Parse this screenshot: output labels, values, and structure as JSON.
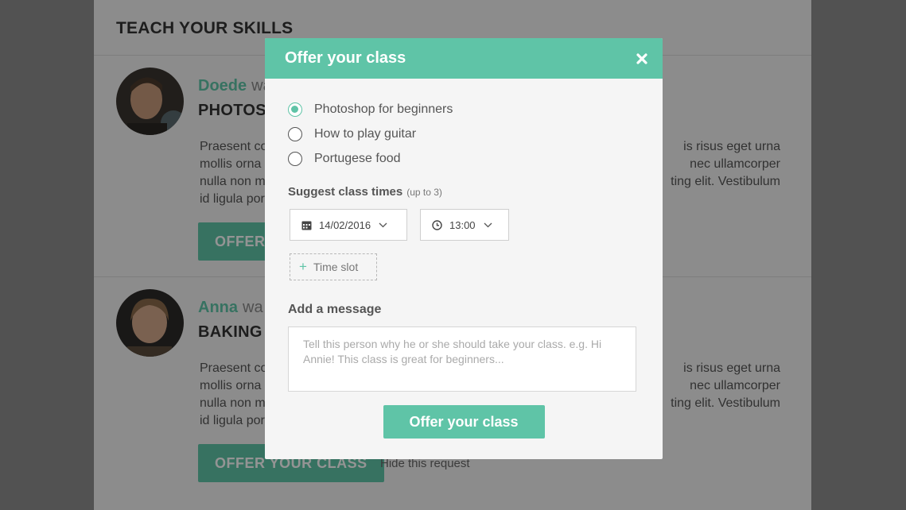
{
  "background": {
    "title": "TEACH YOUR SKILLS",
    "requests": [
      {
        "name": "Doede",
        "wants": "wa",
        "skill": "PHOTOS",
        "text_left": [
          "Praesent co",
          "mollis orna",
          "nulla non m",
          "id ligula por"
        ],
        "text_right": [
          "is risus eget urna",
          "nec ullamcorper",
          "ting elit. Vestibulum"
        ],
        "offer_label": "OFFER Y"
      },
      {
        "name": "Anna",
        "wants": "wa",
        "skill": "BAKING",
        "text_left": [
          "Praesent co",
          "mollis orna",
          "nulla non m",
          "id ligula por"
        ],
        "text_right": [
          "is risus eget urna",
          "nec ullamcorper",
          "ting elit. Vestibulum"
        ],
        "offer_label": "OFFER YOUR CLASS",
        "hide_label": "Hide this request"
      }
    ]
  },
  "modal": {
    "title": "Offer your class",
    "close_icon": "close-icon",
    "classes": [
      {
        "label": "Photoshop for beginners",
        "selected": true
      },
      {
        "label": "How to play guitar",
        "selected": false
      },
      {
        "label": "Portugese food",
        "selected": false
      }
    ],
    "times_label": "Suggest class times",
    "times_hint": "(up to 3)",
    "date_value": "14/02/2016",
    "time_value": "13:00",
    "timeslot_label": "Time slot",
    "message_label": "Add a message",
    "message_placeholder": "Tell this person why he or she should take your class. e.g. Hi Annie! This class is great for beginners...",
    "submit_label": "Offer your class"
  },
  "colors": {
    "accent": "#5fc4a7",
    "text": "#555555"
  }
}
